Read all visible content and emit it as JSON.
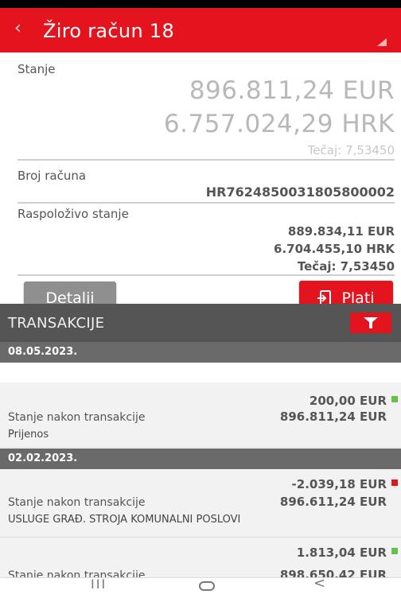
{
  "header": {
    "back_icon": "‹",
    "title": "Žiro račun 18"
  },
  "account": {
    "balance_label": "Stanje",
    "balance_eur": "896.811,24 EUR",
    "balance_hrk": "6.757.024,29 HRK",
    "rate": "Tečaj: 7,53450",
    "number_label": "Broj računa",
    "number": "HR7624850031805800002",
    "available_label": "Raspoloživo stanje",
    "available_eur": "889.834,11 EUR",
    "available_hrk": "6.704.455,10 HRK",
    "available_rate": "Tečaj: 7,53450"
  },
  "buttons": {
    "details": "Detalji",
    "pay": "Plati"
  },
  "transactions": {
    "title": "TRANSAKCIJE",
    "groups": [
      {
        "date": "08.05.2023.",
        "items": [
          {
            "amount": "200,00 EUR",
            "direction": "in",
            "balance_label": "Stanje nakon transakcije",
            "balance": "896.811,24 EUR",
            "description": "Prijenos"
          }
        ]
      },
      {
        "date": "02.02.2023.",
        "items": [
          {
            "amount": "-2.039,18 EUR",
            "direction": "out",
            "balance_label": "Stanje nakon transakcije",
            "balance": "896.611,24 EUR",
            "description": "USLUGE GRAĐ. STROJA KOMUNALNI POSLOVI"
          },
          {
            "amount": "1.813,04 EUR",
            "direction": "in",
            "balance_label": "Stanje nakon transakcije",
            "balance": "898.650,42 EUR",
            "description": ""
          }
        ]
      }
    ]
  },
  "colors": {
    "brand_red": "#e3141e",
    "income_green": "#6abf4b",
    "expense_red": "#e3141e"
  },
  "nav": {
    "recent": "III",
    "back": "<"
  }
}
